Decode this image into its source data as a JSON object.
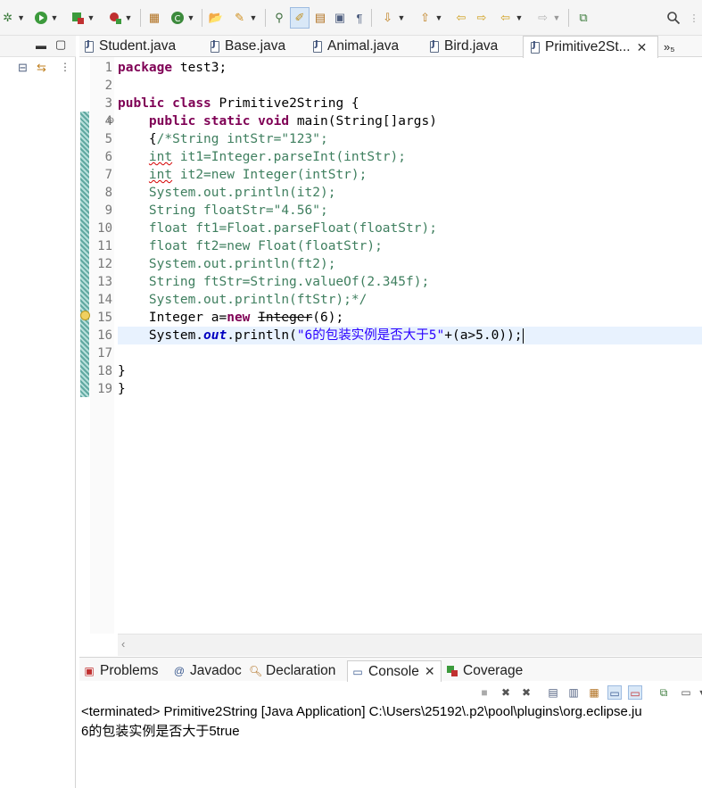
{
  "toolbar": {
    "icons": [
      "debug-icon",
      "run-icon",
      "coverage-icon",
      "external-tools-icon",
      "new-java-package-icon",
      "new-class-icon",
      "open-type-icon",
      "search-icon-tb",
      "toggle-mark-occurrences-icon",
      "highlight-icon",
      "toggle-block-selection-icon",
      "toggle-breadcrumb-icon",
      "show-whitespace-icon",
      "next-annotation-icon",
      "previous-annotation-icon",
      "last-edit-location-icon",
      "back-icon",
      "forward-icon",
      "pin-editor-icon",
      "open-perspective-icon",
      "quick-access-search-icon"
    ]
  },
  "editor": {
    "tabs": [
      {
        "label": "Student.java"
      },
      {
        "label": "Base.java"
      },
      {
        "label": "Animal.java"
      },
      {
        "label": "Bird.java"
      },
      {
        "label": "Primitive2St..."
      }
    ],
    "more_tabs": "»₅",
    "line_numbers": [
      "1",
      "2",
      "3",
      "4",
      "5",
      "6",
      "7",
      "8",
      "9",
      "10",
      "11",
      "12",
      "13",
      "14",
      "15",
      "16",
      "17",
      "18",
      "19"
    ],
    "code": {
      "l1_kw": "package",
      "l1_rest": " test3;",
      "l3_kw1": "public",
      "l3_kw2": "class",
      "l3_rest": " Primitive2String {",
      "l4_indent": "    ",
      "l4_kw1": "public",
      "l4_kw2": "static",
      "l4_kw3": "void",
      "l4_rest": " main(String[]args)",
      "l5_text": "    {",
      "l5_comment": "/*String intStr=\"123\";",
      "l6_comment": "    int it1=Integer.parseInt(intStr);",
      "l7_comment": "    int it2=new Integer(intStr);",
      "l8_comment": "    System.out.println(it2);",
      "l9_comment": "    String floatStr=\"4.56\";",
      "l10_comment": "    float ft1=Float.parseFloat(floatStr);",
      "l11_comment": "    float ft2=new Float(floatStr);",
      "l12_comment": "    System.out.println(ft2);",
      "l13_comment": "    String ftStr=String.valueOf(2.345f);",
      "l14_comment": "    System.out.println(ftStr);*/",
      "l15_a": "    Integer a=",
      "l15_kw": "new",
      "l15_strike": "Integer",
      "l15_b": "(6);",
      "l16_a": "    System.",
      "l16_field": "out",
      "l16_b": ".println(",
      "l16_str": "\"6的包装实例是否大于5\"",
      "l16_c": "+(a>5.0));",
      "l18": "}",
      "l19": "}"
    }
  },
  "bottom": {
    "tabs": [
      {
        "label": "Problems"
      },
      {
        "label": "Javadoc"
      },
      {
        "label": "Declaration"
      },
      {
        "label": "Console"
      },
      {
        "label": "Coverage"
      }
    ],
    "console_status": "<terminated> Primitive2String [Java Application] C:\\Users\\25192\\.p2\\pool\\plugins\\org.eclipse.ju",
    "console_output": "6的包装实例是否大于5true"
  }
}
